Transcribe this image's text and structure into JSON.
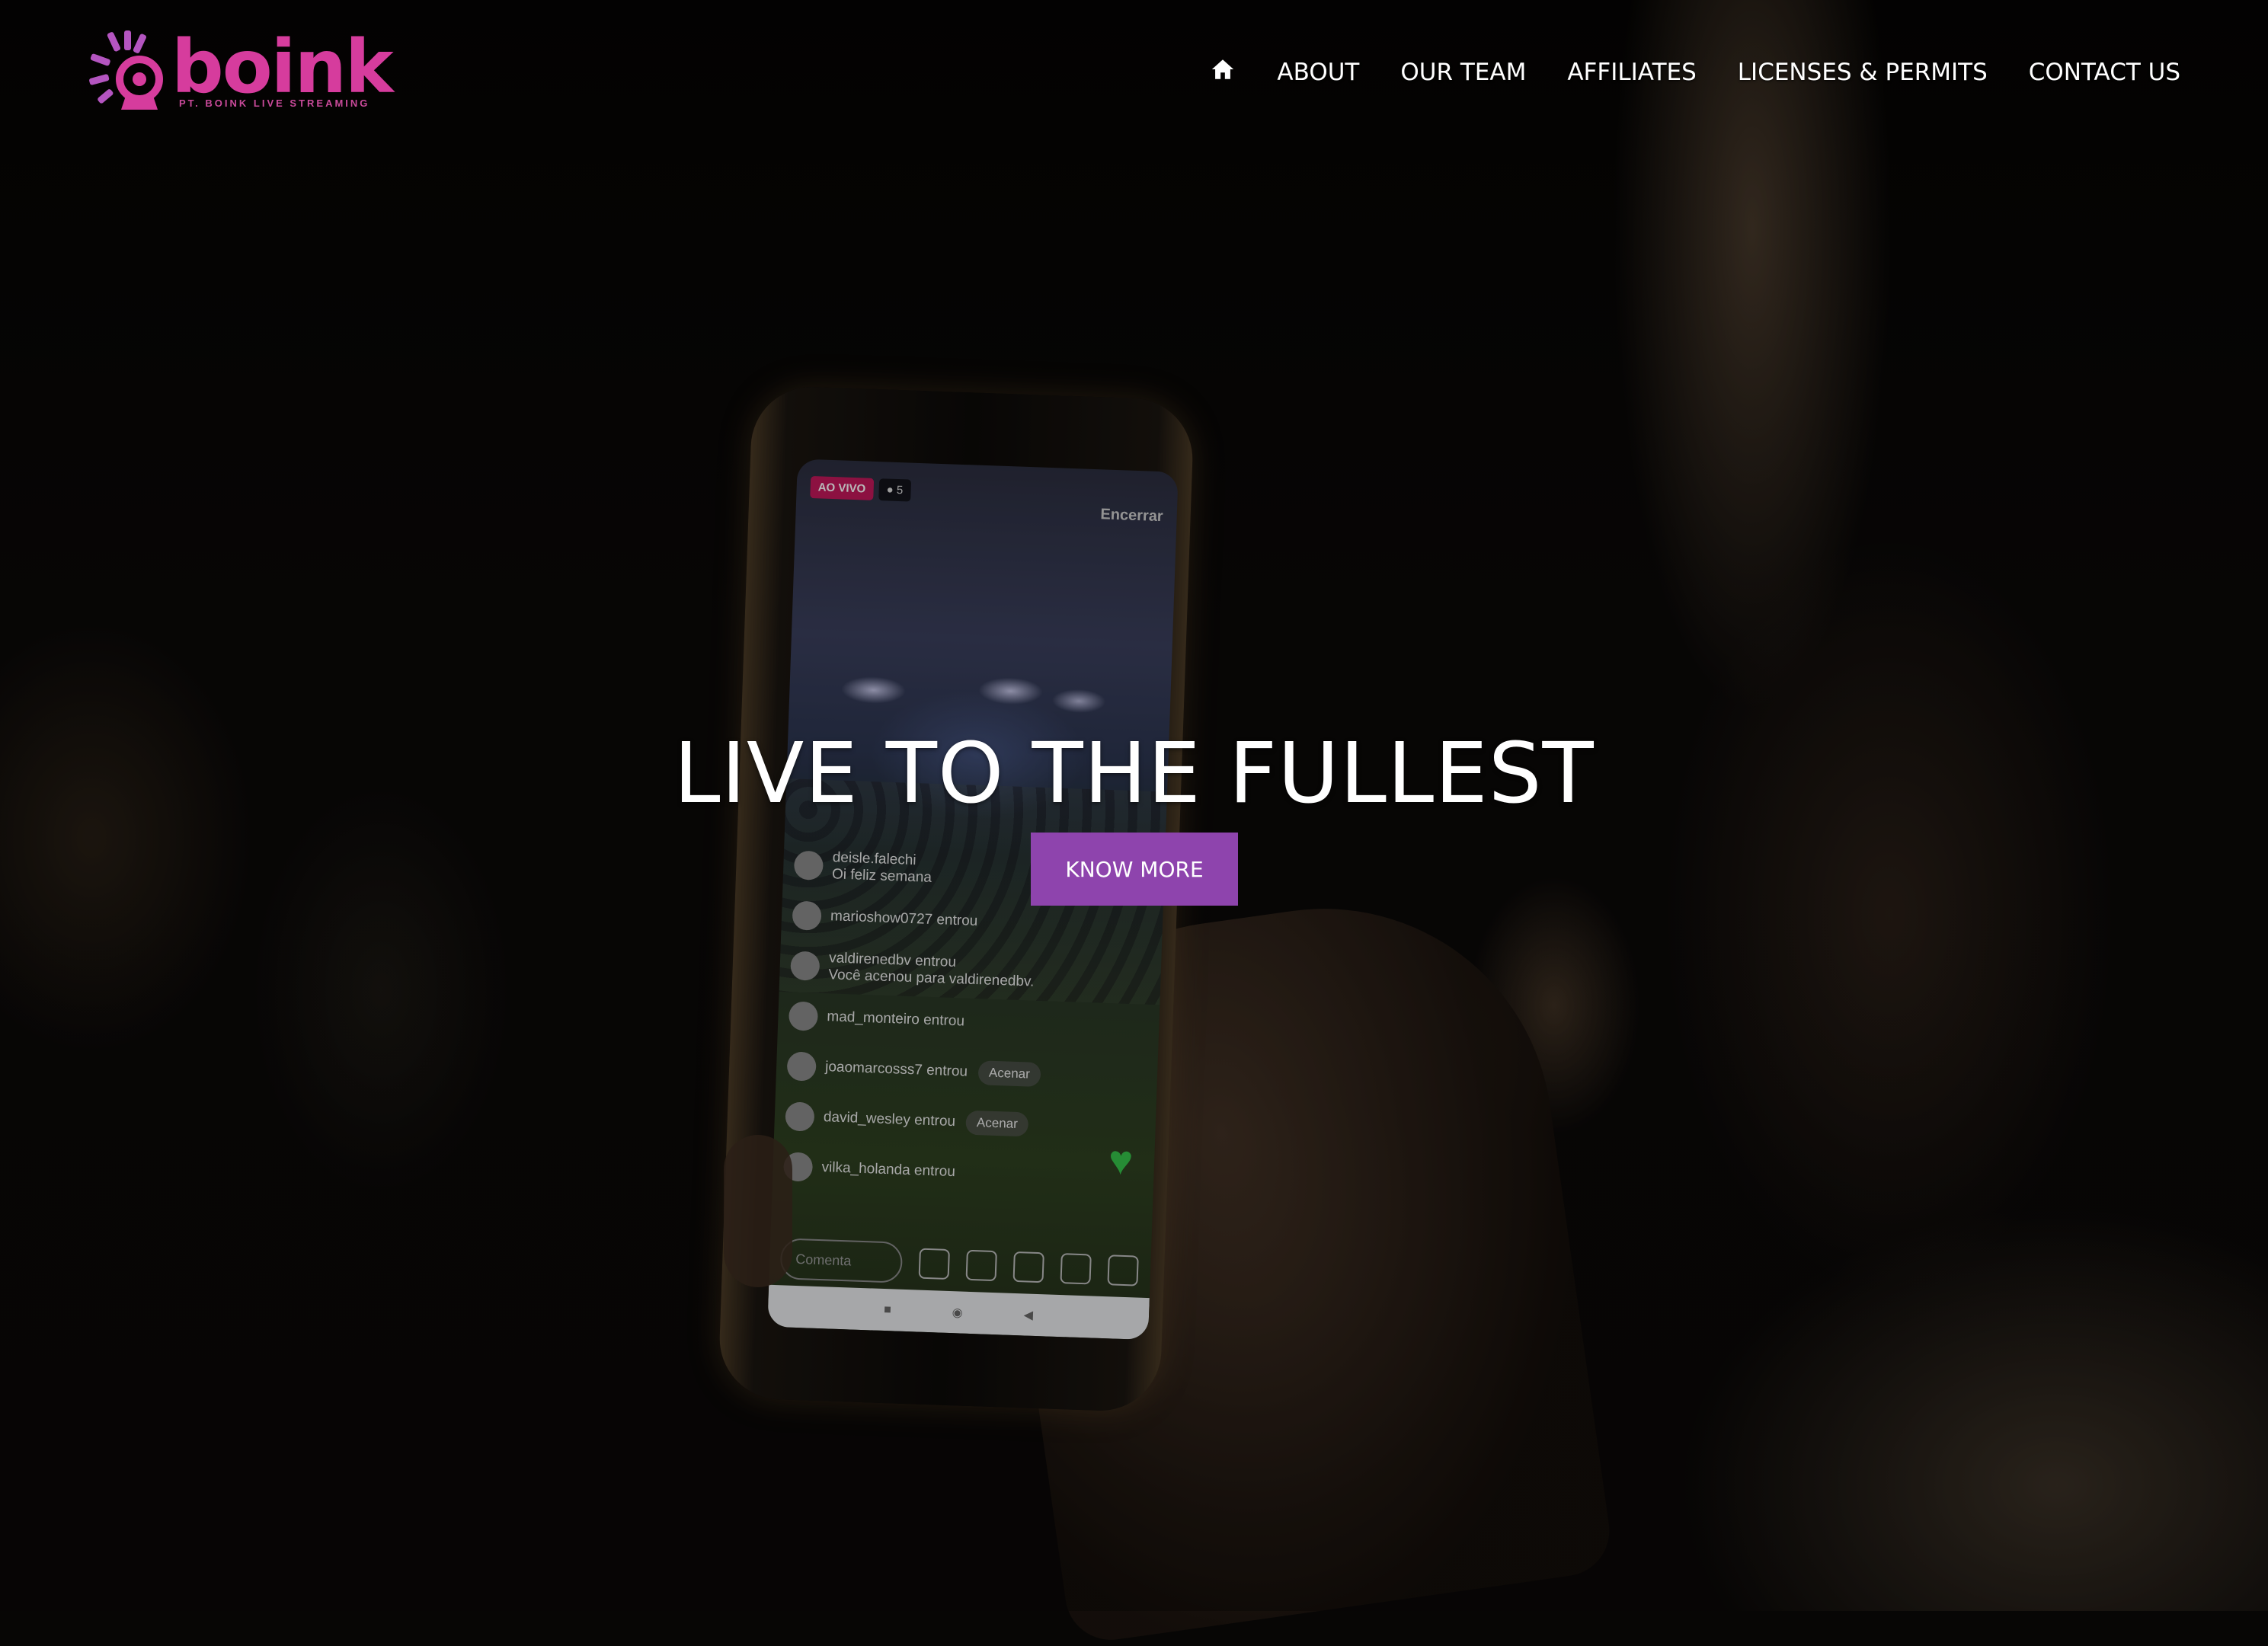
{
  "brand": {
    "name": "boink",
    "tagline": "PT. BOINK LIVE STREAMING",
    "color": "#d63c9d"
  },
  "nav": {
    "home_icon": "home-icon",
    "items": [
      "ABOUT",
      "OUR TEAM",
      "AFFILIATES",
      "LICENSES & PERMITS",
      "CONTACT US"
    ]
  },
  "hero": {
    "title": "LIVE TO THE FULLEST",
    "cta_label": "KNOW MORE",
    "cta_color": "#8e44ad"
  },
  "phone_screen": {
    "live_badge": "AO VIVO",
    "viewer_count": "5",
    "end_label": "Encerrar",
    "comments": [
      {
        "text": "deisle.falechi\nOi feliz semana"
      },
      {
        "text": "marioshow0727 entrou"
      },
      {
        "text": "valdirenedbv entrou\nVocê acenou para valdirenedbv."
      },
      {
        "text": "mad_monteiro entrou"
      },
      {
        "text": "joaomarcosss7 entrou",
        "wave": "Acenar"
      },
      {
        "text": "david_wesley entrou",
        "wave": "Acenar"
      },
      {
        "text": "vilka_holanda entrou"
      }
    ],
    "comment_placeholder": "Comenta"
  }
}
